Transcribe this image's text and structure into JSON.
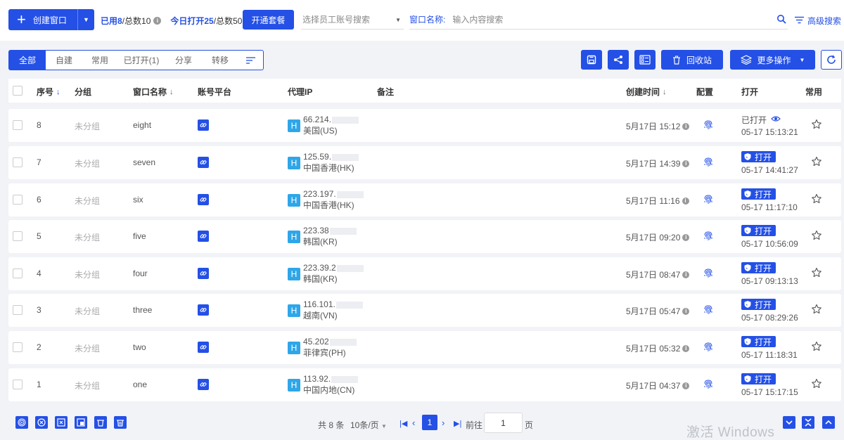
{
  "topbar": {
    "create_label": "创建窗口",
    "used_label": "已用8",
    "total_label": "/总数10",
    "today_label": "今日打开25",
    "today_total_label": "/总数50",
    "open_package_label": "开通套餐",
    "employee_select_placeholder": "选择员工账号搜索",
    "window_name_label": "窗口名称:",
    "window_name_placeholder": "输入内容搜索",
    "advanced_search_label": "高级搜索"
  },
  "tabs": [
    {
      "label": "全部",
      "active": true
    },
    {
      "label": "自建",
      "active": false
    },
    {
      "label": "常用",
      "active": false
    },
    {
      "label": "已打开(1)",
      "active": false
    },
    {
      "label": "分享",
      "active": false
    },
    {
      "label": "转移",
      "active": false
    }
  ],
  "toolbar": {
    "recycle_label": "回收站",
    "more_label": "更多操作"
  },
  "columns": {
    "seq": "序号",
    "group": "分组",
    "window_name": "窗口名称",
    "platform": "账号平台",
    "proxy_ip": "代理IP",
    "note": "备注",
    "created": "创建时间",
    "config": "配置",
    "open": "打开",
    "favorite": "常用"
  },
  "rows": [
    {
      "seq": "8",
      "group": "未分组",
      "name": "eight",
      "ip": "66.214.",
      "region": "美国(US)",
      "created": "5月17日 15:12",
      "status": "opened",
      "status_label": "已打开",
      "open_time": "05-17 15:13:21"
    },
    {
      "seq": "7",
      "group": "未分组",
      "name": "seven",
      "ip": "125.59.",
      "region": "中国香港(HK)",
      "created": "5月17日 14:39",
      "status": "closed",
      "status_label": "打开",
      "open_time": "05-17 14:41:27"
    },
    {
      "seq": "6",
      "group": "未分组",
      "name": "six",
      "ip": "223.197.",
      "region": "中国香港(HK)",
      "created": "5月17日 11:16",
      "status": "closed",
      "status_label": "打开",
      "open_time": "05-17 11:17:10"
    },
    {
      "seq": "5",
      "group": "未分组",
      "name": "five",
      "ip": "223.38",
      "region": "韩国(KR)",
      "created": "5月17日 09:20",
      "status": "closed",
      "status_label": "打开",
      "open_time": "05-17 10:56:09"
    },
    {
      "seq": "4",
      "group": "未分组",
      "name": "four",
      "ip": "223.39.2",
      "region": "韩国(KR)",
      "created": "5月17日 08:47",
      "status": "closed",
      "status_label": "打开",
      "open_time": "05-17 09:13:13"
    },
    {
      "seq": "3",
      "group": "未分组",
      "name": "three",
      "ip": "116.101.",
      "region": "越南(VN)",
      "created": "5月17日 05:47",
      "status": "closed",
      "status_label": "打开",
      "open_time": "05-17 08:29:26"
    },
    {
      "seq": "2",
      "group": "未分组",
      "name": "two",
      "ip": "45.202",
      "region": "菲律宾(PH)",
      "created": "5月17日 05:32",
      "status": "closed",
      "status_label": "打开",
      "open_time": "05-17 11:18:31"
    },
    {
      "seq": "1",
      "group": "未分组",
      "name": "one",
      "ip": "113.92.",
      "region": "中国内地(CN)",
      "created": "5月17日 04:37",
      "status": "closed",
      "status_label": "打开",
      "open_time": "05-17 15:17:15"
    }
  ],
  "pagination": {
    "total_label": "共 8 条",
    "page_size_label": "10条/页",
    "current_page": "1",
    "goto_label": "前往",
    "goto_value": "1",
    "page_suffix": "页"
  },
  "watermark": "激活 Windows",
  "colors": {
    "accent": "#2450e6",
    "proxy_badge": "#2fa6e8",
    "background": "#f1f3f7"
  }
}
